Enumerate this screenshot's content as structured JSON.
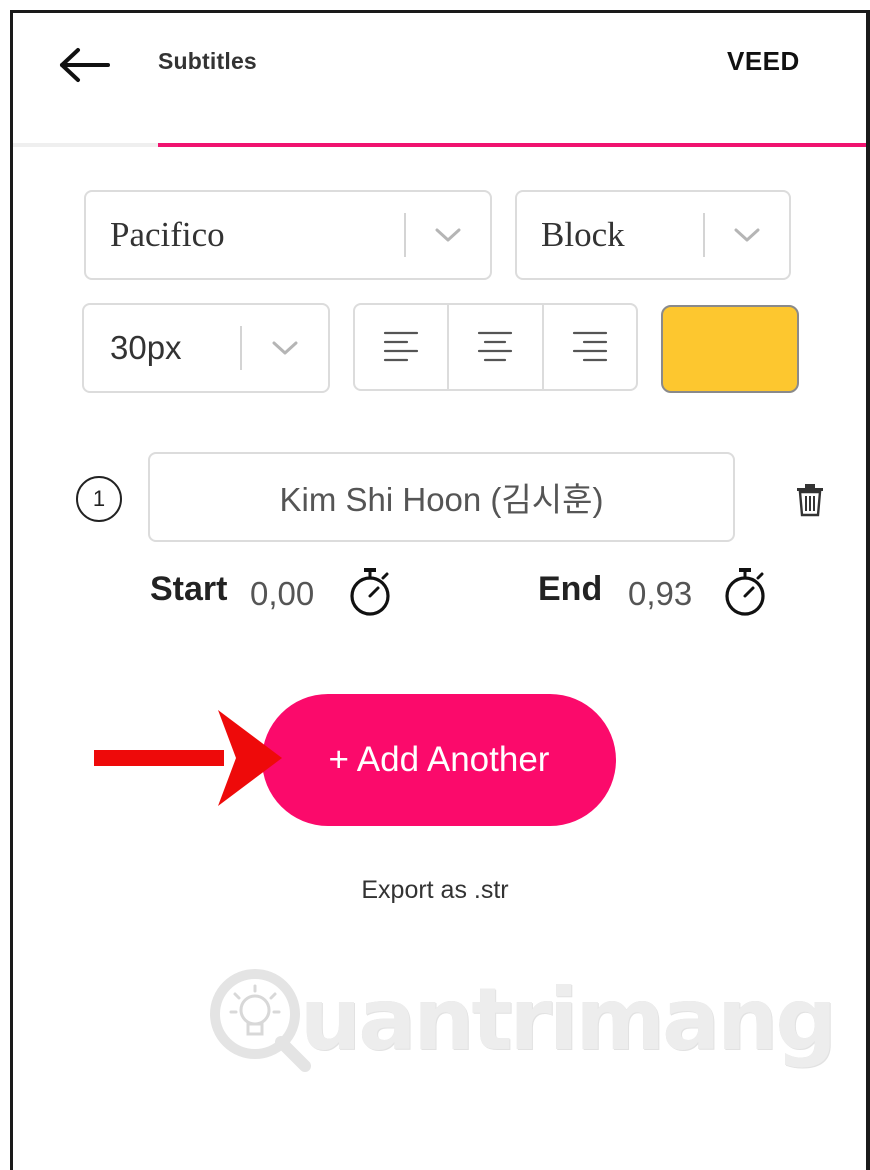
{
  "header": {
    "back_icon": "arrow-left-icon",
    "title": "Subtitles",
    "brand": "VEED"
  },
  "colors": {
    "accent": "#f0136f",
    "add_button": "#fb0a6b",
    "subtitle_color": "#fdc72f",
    "annotation_arrow": "#ee0a0a"
  },
  "controls": {
    "font_select": {
      "value": "Pacifico",
      "icon": "chevron-down-icon"
    },
    "style_select": {
      "value": "Block",
      "icon": "chevron-down-icon"
    },
    "size_select": {
      "value": "30px",
      "icon": "chevron-down-icon"
    },
    "alignment": [
      "align-left-icon",
      "align-center-icon",
      "align-right-icon"
    ]
  },
  "subtitle_row": {
    "number": "1",
    "text": "Kim Shi Hoon (김시훈)",
    "start_label": "Start",
    "start_value": "0,00",
    "end_label": "End",
    "end_value": "0,93",
    "timer_icon": "stopwatch-icon",
    "delete_icon": "trash-icon"
  },
  "actions": {
    "add_label": "+ Add Another",
    "export_label": "Export as .str"
  },
  "watermark": {
    "text": "uantrimang",
    "icon": "lightbulb-logo-icon"
  }
}
